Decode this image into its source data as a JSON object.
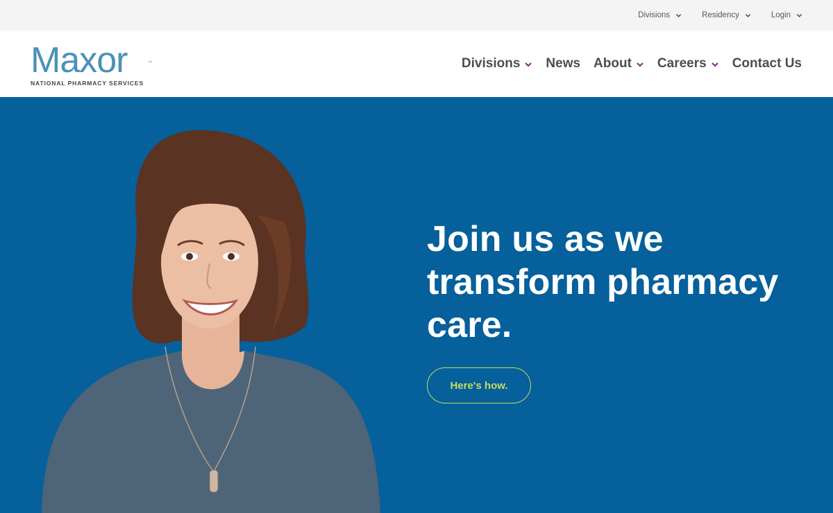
{
  "utility_nav": {
    "items": [
      {
        "label": "Divisions"
      },
      {
        "label": "Residency"
      },
      {
        "label": "Login"
      }
    ]
  },
  "brand": {
    "name": "Maxor",
    "trademark": "™",
    "tagline": "NATIONAL PHARMACY SERVICES",
    "color": "#4a91b8"
  },
  "main_nav": {
    "items": [
      {
        "label": "Divisions",
        "has_dropdown": true
      },
      {
        "label": "News",
        "has_dropdown": false
      },
      {
        "label": "About",
        "has_dropdown": true
      },
      {
        "label": "Careers",
        "has_dropdown": true
      },
      {
        "label": "Contact Us",
        "has_dropdown": false
      }
    ],
    "chevron_color": "#8b1f8f"
  },
  "hero": {
    "heading_line1": "Join us as we",
    "heading_line2": "transform pharmacy",
    "heading_line3": "care.",
    "cta_label": "Here's how.",
    "background_color": "#06609b",
    "cta_color": "#c9dc5a"
  }
}
